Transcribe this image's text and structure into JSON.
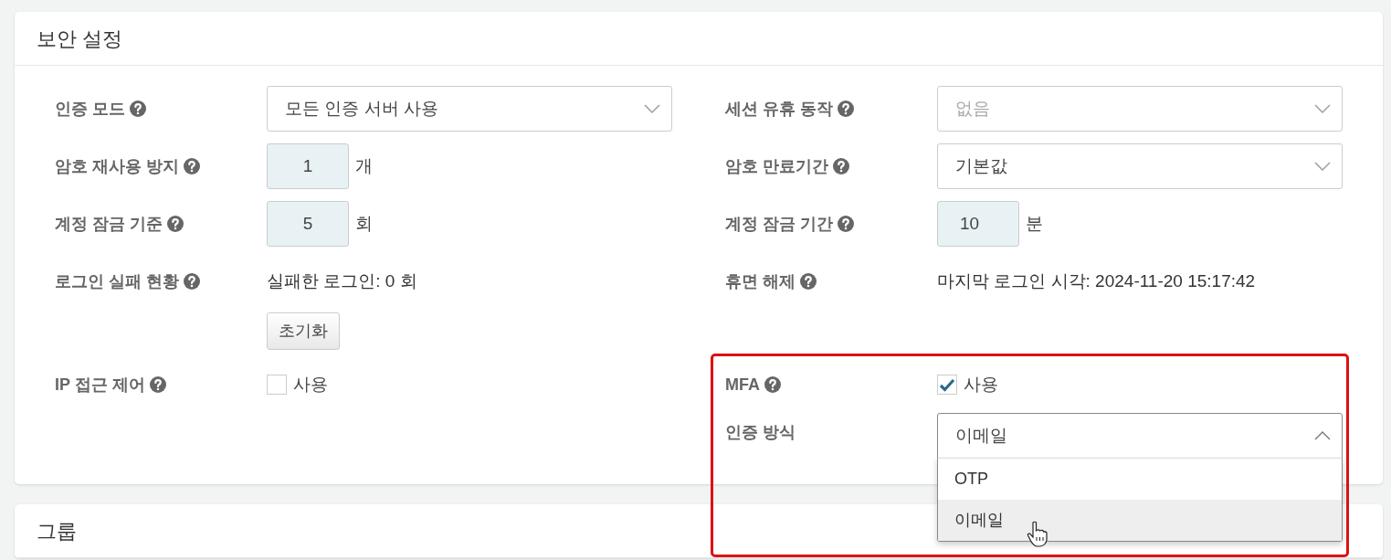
{
  "cards": [
    {
      "title": "보안 설정",
      "rows": [
        {
          "left": {
            "kind": "select",
            "label": "인증 모드",
            "help": true,
            "value": "모든 인증 서버 사용",
            "disabled": false,
            "expanded": false
          },
          "right": {
            "kind": "select",
            "label": "세션 유휴 동작",
            "help": true,
            "value": "없음",
            "disabled": true,
            "expanded": false
          }
        },
        {
          "left": {
            "kind": "number",
            "label": "암호 재사용 방지",
            "help": true,
            "value": "1",
            "unit": "개"
          },
          "right": {
            "kind": "select",
            "label": "암호 만료기간",
            "help": true,
            "value": "기본값",
            "disabled": false,
            "expanded": false
          }
        },
        {
          "left": {
            "kind": "number",
            "label": "계정 잠금 기준",
            "help": true,
            "value": "5",
            "unit": "회"
          },
          "right": {
            "kind": "number",
            "label": "계정 잠금 기간",
            "help": true,
            "value": "10",
            "unit": "분"
          }
        },
        {
          "left": {
            "kind": "text",
            "label": "로그인 실패 현황",
            "help": true,
            "value": "실패한 로그인: 0 회",
            "button": "초기화"
          },
          "right": {
            "kind": "text",
            "label": "휴면 해제",
            "help": true,
            "value": "마지막 로그인 시각: 2024-11-20 15:17:42"
          }
        },
        {
          "left": {
            "kind": "checkbox",
            "label": "IP 접근 제어",
            "help": true,
            "checked": false,
            "text": "사용"
          },
          "right": {
            "kind": "checkbox",
            "label": "MFA",
            "help": true,
            "checked": true,
            "text": "사용"
          }
        },
        {
          "right": {
            "kind": "select",
            "label": "인증 방식",
            "help": false,
            "value": "이메일",
            "disabled": false,
            "expanded": true,
            "options": [
              {
                "label": "OTP",
                "selected": false
              },
              {
                "label": "이메일",
                "selected": true
              }
            ]
          }
        }
      ]
    },
    {
      "title": "그룹"
    }
  ]
}
